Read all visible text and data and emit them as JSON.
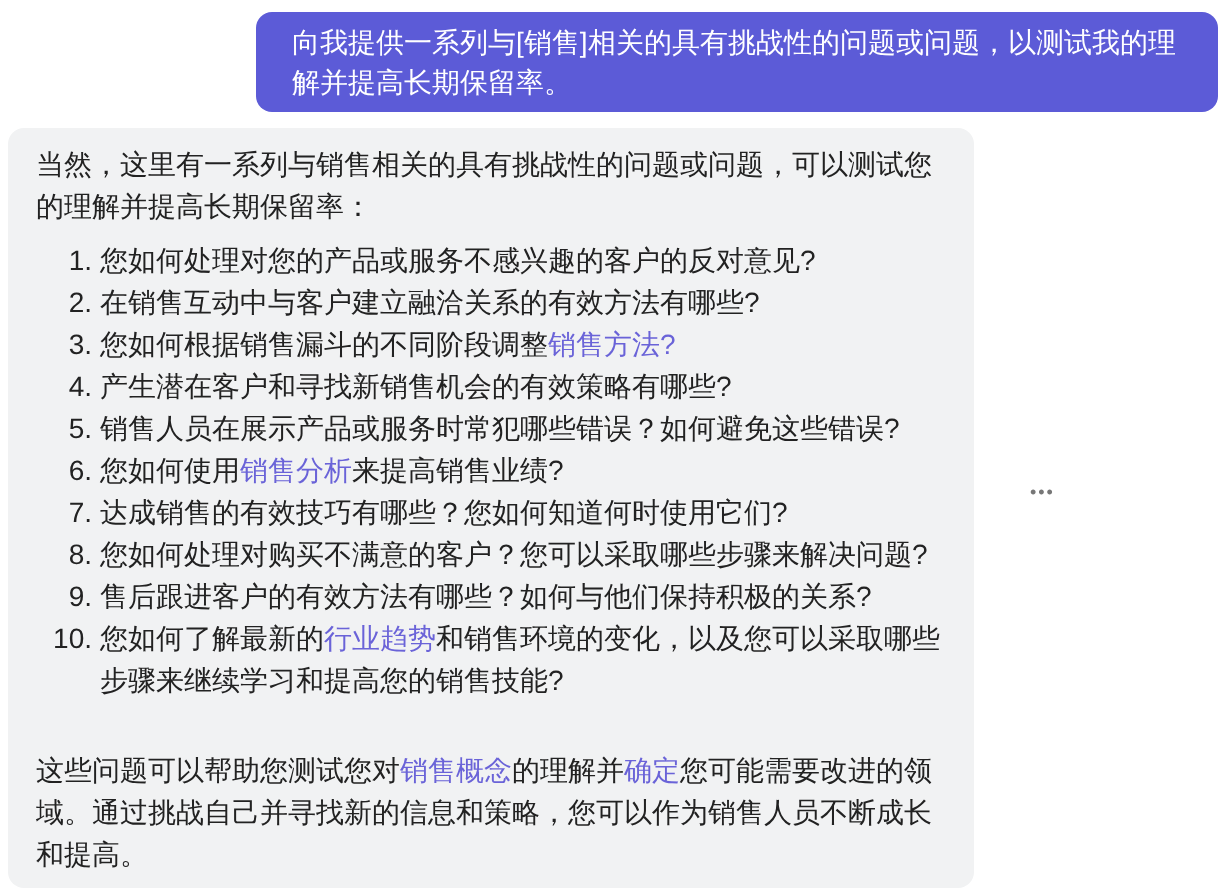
{
  "user_message": {
    "text": "向我提供一系列与[销售]相关的具有挑战性的问题或问题，以测试我的理解并提高长期保留率。"
  },
  "assistant_message": {
    "intro": "当然，这里有一系列与销售相关的具有挑战性的问题或问题，可以测试您的理解并提高长期保留率：",
    "items": [
      {
        "number": "1.",
        "segments": [
          {
            "text": "您如何处理对您的产品或服务不感兴趣的客户的反对意见?",
            "link": false
          }
        ]
      },
      {
        "number": "2.",
        "segments": [
          {
            "text": "在销售互动中与客户建立融洽关系的有效方法有哪些?",
            "link": false
          }
        ]
      },
      {
        "number": "3.",
        "segments": [
          {
            "text": "您如何根据销售漏斗的不同阶段调整",
            "link": false
          },
          {
            "text": "销售方法?",
            "link": true
          }
        ]
      },
      {
        "number": "4.",
        "segments": [
          {
            "text": "产生潜在客户和寻找新销售机会的有效策略有哪些?",
            "link": false
          }
        ]
      },
      {
        "number": "5.",
        "segments": [
          {
            "text": "销售人员在展示产品或服务时常犯哪些错误？如何避免这些错误?",
            "link": false
          }
        ]
      },
      {
        "number": "6.",
        "segments": [
          {
            "text": "您如何使用",
            "link": false
          },
          {
            "text": "销售分析",
            "link": true
          },
          {
            "text": "来提高销售业绩?",
            "link": false
          }
        ]
      },
      {
        "number": "7.",
        "segments": [
          {
            "text": "达成销售的有效技巧有哪些？您如何知道何时使用它们?",
            "link": false
          }
        ]
      },
      {
        "number": "8.",
        "segments": [
          {
            "text": "您如何处理对购买不满意的客户？您可以采取哪些步骤来解决问题?",
            "link": false
          }
        ]
      },
      {
        "number": "9.",
        "segments": [
          {
            "text": "售后跟进客户的有效方法有哪些？如何与他们保持积极的关系?",
            "link": false
          }
        ]
      },
      {
        "number": "10.",
        "segments": [
          {
            "text": "您如何了解最新的",
            "link": false
          },
          {
            "text": "行业趋势",
            "link": true
          },
          {
            "text": "和销售环境的变化，以及您可以采取哪些步骤来继续学习和提高您的销售技能?",
            "link": false
          }
        ]
      }
    ],
    "closing": [
      {
        "text": "这些问题可以帮助您测试您对",
        "link": false
      },
      {
        "text": "销售概念",
        "link": true
      },
      {
        "text": "的理解并",
        "link": false
      },
      {
        "text": "确定",
        "link": true
      },
      {
        "text": "您可能需要改进的领域。通过挑战自己并寻找新的信息和策略，您可以作为销售人员不断成长和提高。",
        "link": false
      }
    ]
  },
  "more_button": {
    "label": "•••"
  }
}
